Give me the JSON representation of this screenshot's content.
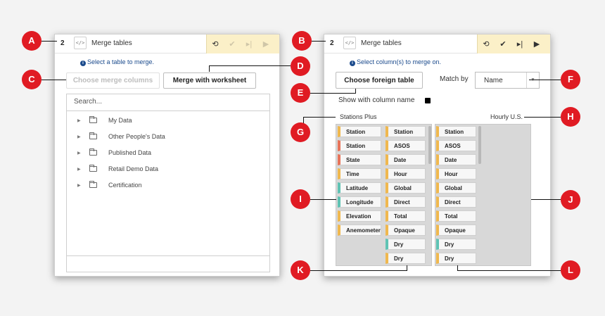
{
  "left_panel": {
    "step": "2",
    "code_icon": "</>",
    "title": "Merge tables",
    "toolbar": [
      {
        "icon": "undo-icon",
        "glyph": "⟲",
        "enabled": true
      },
      {
        "icon": "check-icon",
        "glyph": "✔",
        "enabled": false
      },
      {
        "icon": "step-icon",
        "glyph": "▸|",
        "enabled": false
      },
      {
        "icon": "play-icon",
        "glyph": "▶",
        "enabled": false
      }
    ],
    "info": "Select a table to merge.",
    "choose_merge_columns": "Choose merge columns",
    "merge_with_worksheet": "Merge with worksheet",
    "search_placeholder": "Search...",
    "tree": [
      "My Data",
      "Other People's Data",
      "Published Data",
      "Retail Demo Data",
      "Certification"
    ]
  },
  "right_panel": {
    "step": "2",
    "code_icon": "</>",
    "title": "Merge tables",
    "toolbar": [
      {
        "icon": "undo-icon",
        "glyph": "⟲",
        "enabled": true
      },
      {
        "icon": "check-icon",
        "glyph": "✔",
        "enabled": true
      },
      {
        "icon": "step-icon",
        "glyph": "▸|",
        "enabled": true
      },
      {
        "icon": "play-icon",
        "glyph": "▶",
        "enabled": true
      }
    ],
    "info": "Select column(s) to merge on.",
    "choose_foreign_table": "Choose foreign table",
    "match_by_label": "Match by",
    "match_by_value": "Name",
    "show_with_column_name": "Show with column name",
    "left_table_name": "Stations Plus",
    "right_table_name": "Hourly U.S.",
    "left_columns": [
      {
        "name": "Station",
        "color": "orange"
      },
      {
        "name": "Station",
        "color": "red"
      },
      {
        "name": "State",
        "color": "red"
      },
      {
        "name": "Time",
        "color": "orange"
      },
      {
        "name": "Latitude",
        "color": "teal"
      },
      {
        "name": "Longitude",
        "color": "teal"
      },
      {
        "name": "Elevation",
        "color": "orange"
      },
      {
        "name": "Anemometer",
        "color": "orange"
      }
    ],
    "middle_columns": [
      {
        "name": "Station",
        "color": "orange"
      },
      {
        "name": "ASOS",
        "color": "orange"
      },
      {
        "name": "Date",
        "color": "orange"
      },
      {
        "name": "Hour",
        "color": "orange"
      },
      {
        "name": "Global",
        "color": "orange"
      },
      {
        "name": "Direct",
        "color": "orange"
      },
      {
        "name": "Total",
        "color": "orange"
      },
      {
        "name": "Opaque",
        "color": "orange"
      },
      {
        "name": "Dry",
        "color": "teal"
      },
      {
        "name": "Dry",
        "color": "orange"
      }
    ],
    "right_columns": [
      {
        "name": "Station",
        "color": "orange"
      },
      {
        "name": "ASOS",
        "color": "orange"
      },
      {
        "name": "Date",
        "color": "orange"
      },
      {
        "name": "Hour",
        "color": "orange"
      },
      {
        "name": "Global",
        "color": "orange"
      },
      {
        "name": "Direct",
        "color": "orange"
      },
      {
        "name": "Total",
        "color": "orange"
      },
      {
        "name": "Opaque",
        "color": "orange"
      },
      {
        "name": "Dry",
        "color": "teal"
      },
      {
        "name": "Dry",
        "color": "orange"
      }
    ]
  },
  "callouts": [
    "A",
    "B",
    "C",
    "D",
    "E",
    "F",
    "G",
    "H",
    "I",
    "J",
    "K",
    "L"
  ],
  "colors": {
    "callout": "#e01b23",
    "toolbar": "#fbf0c8",
    "info": "#1a4a8c",
    "chip_orange": "#f0b84e",
    "chip_red": "#e8745a",
    "chip_teal": "#5fc3b4"
  }
}
